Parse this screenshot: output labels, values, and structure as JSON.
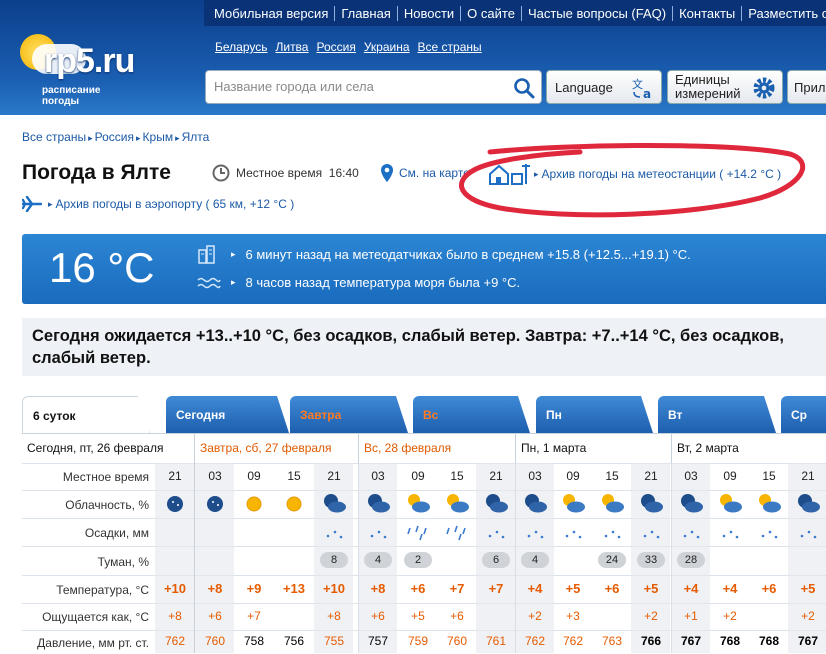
{
  "header": {
    "logo_text": "rp5.ru",
    "logo_sub1": "расписание",
    "logo_sub2": "погоды",
    "nav": [
      "Мобильная версия",
      "Главная",
      "Новости",
      "О сайте",
      "Частые вопросы (FAQ)",
      "Контакты",
      "Разместить о"
    ],
    "countries": [
      "Беларусь",
      "Литва",
      "Россия",
      "Украина",
      "Все страны"
    ],
    "search_placeholder": "Название города или села",
    "language_label": "Language",
    "units_label_1": "Единицы",
    "units_label_2": "измерений",
    "apps_label": "Прил"
  },
  "breadcrumb": [
    "Все страны",
    "Россия",
    "Крым",
    "Ялта"
  ],
  "page": {
    "title": "Погода в Ялте",
    "local_time_label": "Местное время",
    "local_time": "16:40",
    "map_link": "См. на карте",
    "archive_station": "Архив погоды на метеостанции ( +14.2 °C )",
    "archive_airport": "Архив погоды в аэропорту ( 65 км, +12 °C )"
  },
  "current": {
    "temp": "16 °C",
    "sensor_text": "6 минут назад на метеодатчиках было в среднем +15.8 (+12.5...+19.1) °C.",
    "sea_text": "8 часов назад температура моря была +9 °C."
  },
  "summary": "Сегодня ожидается +13..+10 °C, без осадков, слабый ветер. Завтра: +7..+14 °C, без осадков, слабый ветер.",
  "tabs": [
    "6 суток",
    "Сегодня",
    "Завтра",
    "Вс",
    "Пн",
    "Вт",
    "Ср"
  ],
  "days": [
    "Сегодня, пт, 26 февраля",
    "Завтра, сб, 27 февраля",
    "Вс, 28 февраля",
    "Пн, 1 марта",
    "Вт, 2 марта"
  ],
  "row_labels": {
    "hours": "Местное время",
    "cloud": "Облачность, %",
    "precip": "Осадки, мм",
    "fog": "Туман, %",
    "temp": "Температура, °C",
    "feels": "Ощущается как, °C",
    "pressure": "Давление, мм рт. ст."
  },
  "hours": [
    "21",
    "03",
    "09",
    "15",
    "21",
    "03",
    "09",
    "15",
    "21",
    "03",
    "09",
    "15",
    "21",
    "03",
    "09",
    "15",
    "21"
  ],
  "cloud_icons": [
    "moon-clear",
    "moon-clear",
    "sun",
    "sun",
    "moon-cloud",
    "moon-cloud",
    "sun-cloud",
    "sun-cloud",
    "moon-cloud",
    "moon-cloud",
    "sun-cloud",
    "sun-cloud",
    "moon-cloud",
    "moon-cloud",
    "sun-cloud",
    "sun-cloud",
    "moon-cloud"
  ],
  "precip_icons": [
    "",
    "",
    "",
    "",
    "drops",
    "drops",
    "rain",
    "rain",
    "drops",
    "drops",
    "drops",
    "drops",
    "drops",
    "drops",
    "drops",
    "drops",
    "drops"
  ],
  "fog": [
    "",
    "",
    "",
    "",
    "8",
    "4",
    "2",
    "",
    "6",
    "4",
    "",
    "24",
    "33",
    "28",
    "",
    "",
    ""
  ],
  "temps": [
    "+10",
    "+8",
    "+9",
    "+13",
    "+10",
    "+8",
    "+6",
    "+7",
    "+7",
    "+4",
    "+5",
    "+6",
    "+5",
    "+4",
    "+4",
    "+6",
    "+5"
  ],
  "feels": [
    "+8",
    "+6",
    "+7",
    "",
    "+8",
    "+6",
    "+5",
    "+6",
    "",
    "+2",
    "+3",
    "",
    "+2",
    "+1",
    "+2",
    "",
    "+2"
  ],
  "pressure": [
    "762",
    "760",
    "758",
    "756",
    "755",
    "757",
    "759",
    "760",
    "761",
    "762",
    "762",
    "763",
    "766",
    "767",
    "768",
    "768",
    "767"
  ],
  "colors": {
    "accent": "#1a6bbd",
    "orange": "#e55b00",
    "annotation": "#e0283c"
  }
}
